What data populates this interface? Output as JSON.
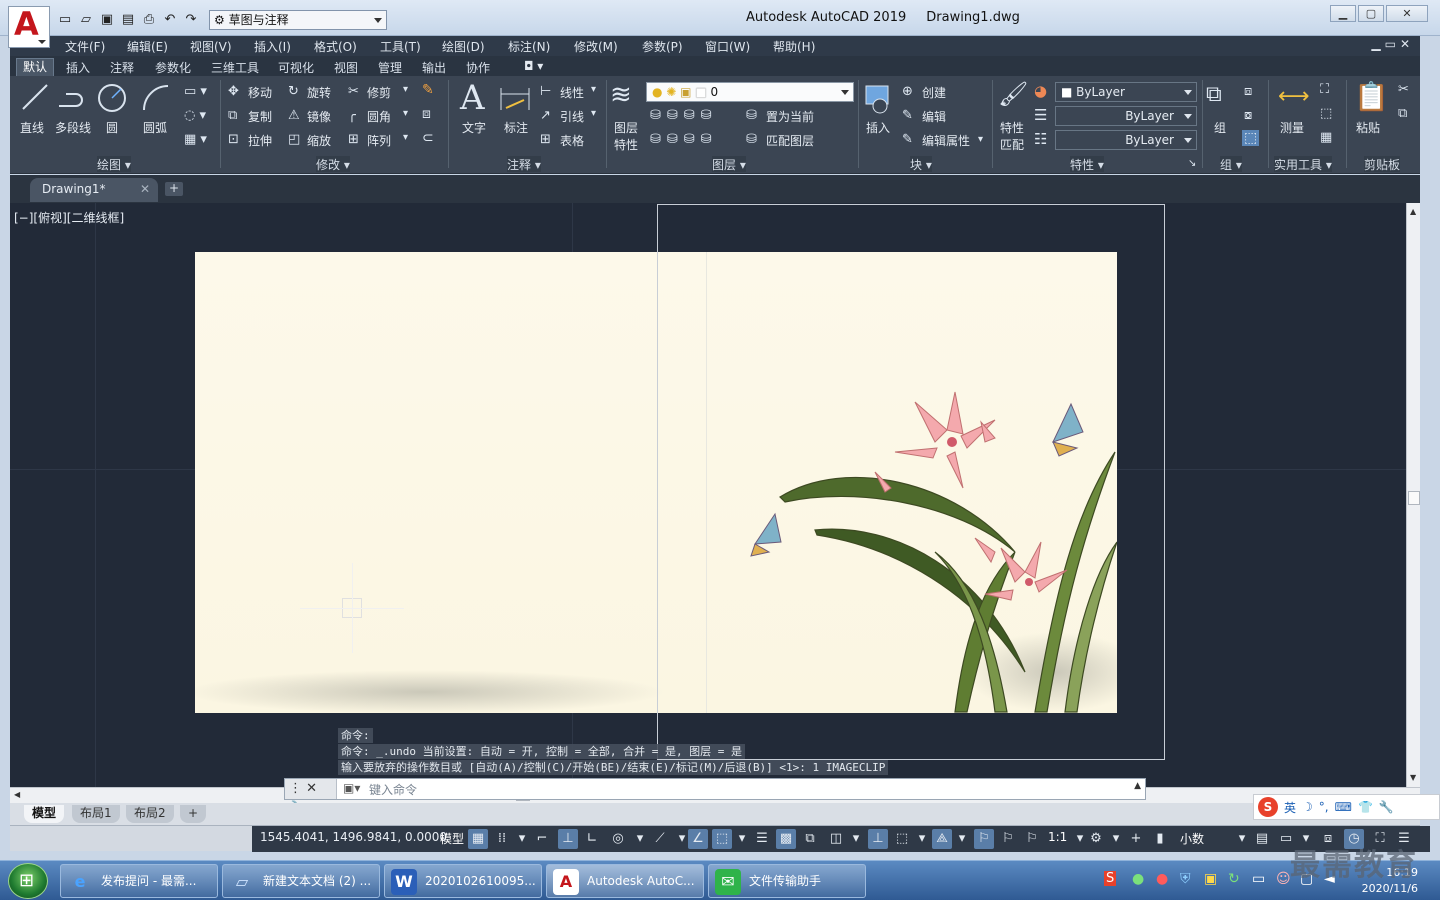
{
  "window": {
    "app_title": "Autodesk AutoCAD 2019",
    "doc_title": "Drawing1.dwg",
    "workspace": "草图与注释"
  },
  "menu": [
    "文件(F)",
    "编辑(E)",
    "视图(V)",
    "插入(I)",
    "格式(O)",
    "工具(T)",
    "绘图(D)",
    "标注(N)",
    "修改(M)",
    "参数(P)",
    "窗口(W)",
    "帮助(H)"
  ],
  "ribbon_tabs": [
    "默认",
    "插入",
    "注释",
    "参数化",
    "三维工具",
    "可视化",
    "视图",
    "管理",
    "输出",
    "协作"
  ],
  "draw": {
    "line": "直线",
    "polyline": "多段线",
    "circle": "圆",
    "arc": "圆弧",
    "title": "绘图"
  },
  "modify": {
    "move": "移动",
    "rotate": "旋转",
    "trim": "修剪",
    "copy": "复制",
    "mirror": "镜像",
    "fillet": "圆角",
    "stretch": "拉伸",
    "scale": "缩放",
    "array": "阵列",
    "title": "修改"
  },
  "annotation": {
    "text": "文字",
    "dim": "标注",
    "linear": "线性",
    "leader": "引线",
    "table": "表格",
    "title": "注释"
  },
  "layers": {
    "props_l1": "图层",
    "props_l2": "特性",
    "current_layer": "0",
    "set_current": "置为当前",
    "match_layer": "匹配图层",
    "title": "图层"
  },
  "block": {
    "insert": "插入",
    "create": "创建",
    "edit": "编辑",
    "edit_attr": "编辑属性",
    "title": "块"
  },
  "properties": {
    "match_l1": "特性",
    "match_l2": "匹配",
    "color": "ByLayer",
    "linetype": "ByLayer",
    "lineweight": "ByLayer",
    "title": "特性"
  },
  "groups": {
    "group": "组",
    "title": "组"
  },
  "utilities": {
    "measure": "测量",
    "title": "实用工具"
  },
  "clipboard": {
    "paste": "粘贴",
    "title": "剪贴板"
  },
  "doc_tab": "Drawing1*",
  "viewport_label": "[−][俯视][二维线框]",
  "command_history": [
    "命令:",
    "命令:  _.undo 当前设置: 自动 = 开, 控制 = 全部, 合并 = 是, 图层 = 是",
    "输入要放弃的操作数目或 [自动(A)/控制(C)/开始(BE)/结束(E)/标记(M)/后退(B)] <1>: 1 IMAGECLIP"
  ],
  "command_placeholder": "键入命令",
  "layout_tabs": [
    "模型",
    "布局1",
    "布局2"
  ],
  "status": {
    "coords": "1545.4041, 1496.9841, 0.0000",
    "model": "模型",
    "scale": "1:1",
    "units": "小数"
  },
  "taskbar": {
    "items": [
      "发布提问 - 最需...",
      "新建文本文档 (2) ...",
      "2020102610095...",
      "Autodesk AutoC...",
      "文件传输助手"
    ],
    "time": "16:19",
    "date": "2020/11/6"
  },
  "ime": {
    "lang": "英"
  },
  "watermark": "最需教育",
  "colors": {
    "canvas": "#222a38",
    "ribbon": "#3b4553",
    "accent": "#c4161c"
  }
}
